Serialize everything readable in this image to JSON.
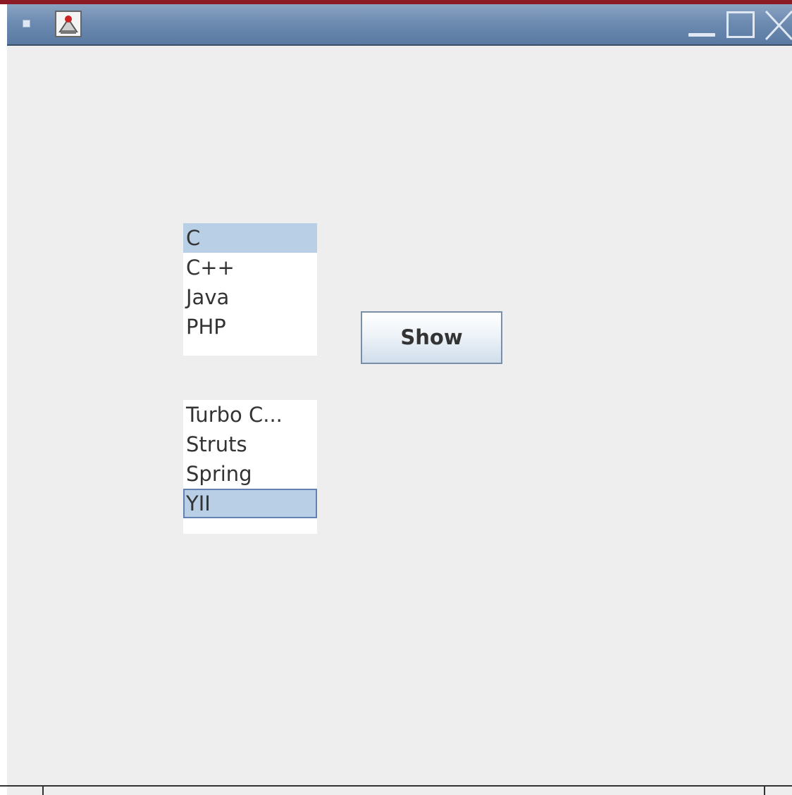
{
  "window": {
    "icons": {
      "system_menu": "system-menu-icon",
      "app": "java-app-icon",
      "minimize": "minimize-icon",
      "maximize": "maximize-icon",
      "close": "close-icon"
    }
  },
  "languages_list": {
    "items": [
      "C",
      "C++",
      "Java",
      "PHP"
    ],
    "selected": "C"
  },
  "frameworks_list": {
    "items": [
      "Turbo C...",
      "Struts",
      "Spring",
      "YII"
    ],
    "selected": "YII"
  },
  "show_button": {
    "label": "Show"
  },
  "colors": {
    "selection": "#b8cfe5",
    "focus_border": "#6382b3",
    "titlebar": "#6d8bb1",
    "window_background": "#eeeeee"
  }
}
